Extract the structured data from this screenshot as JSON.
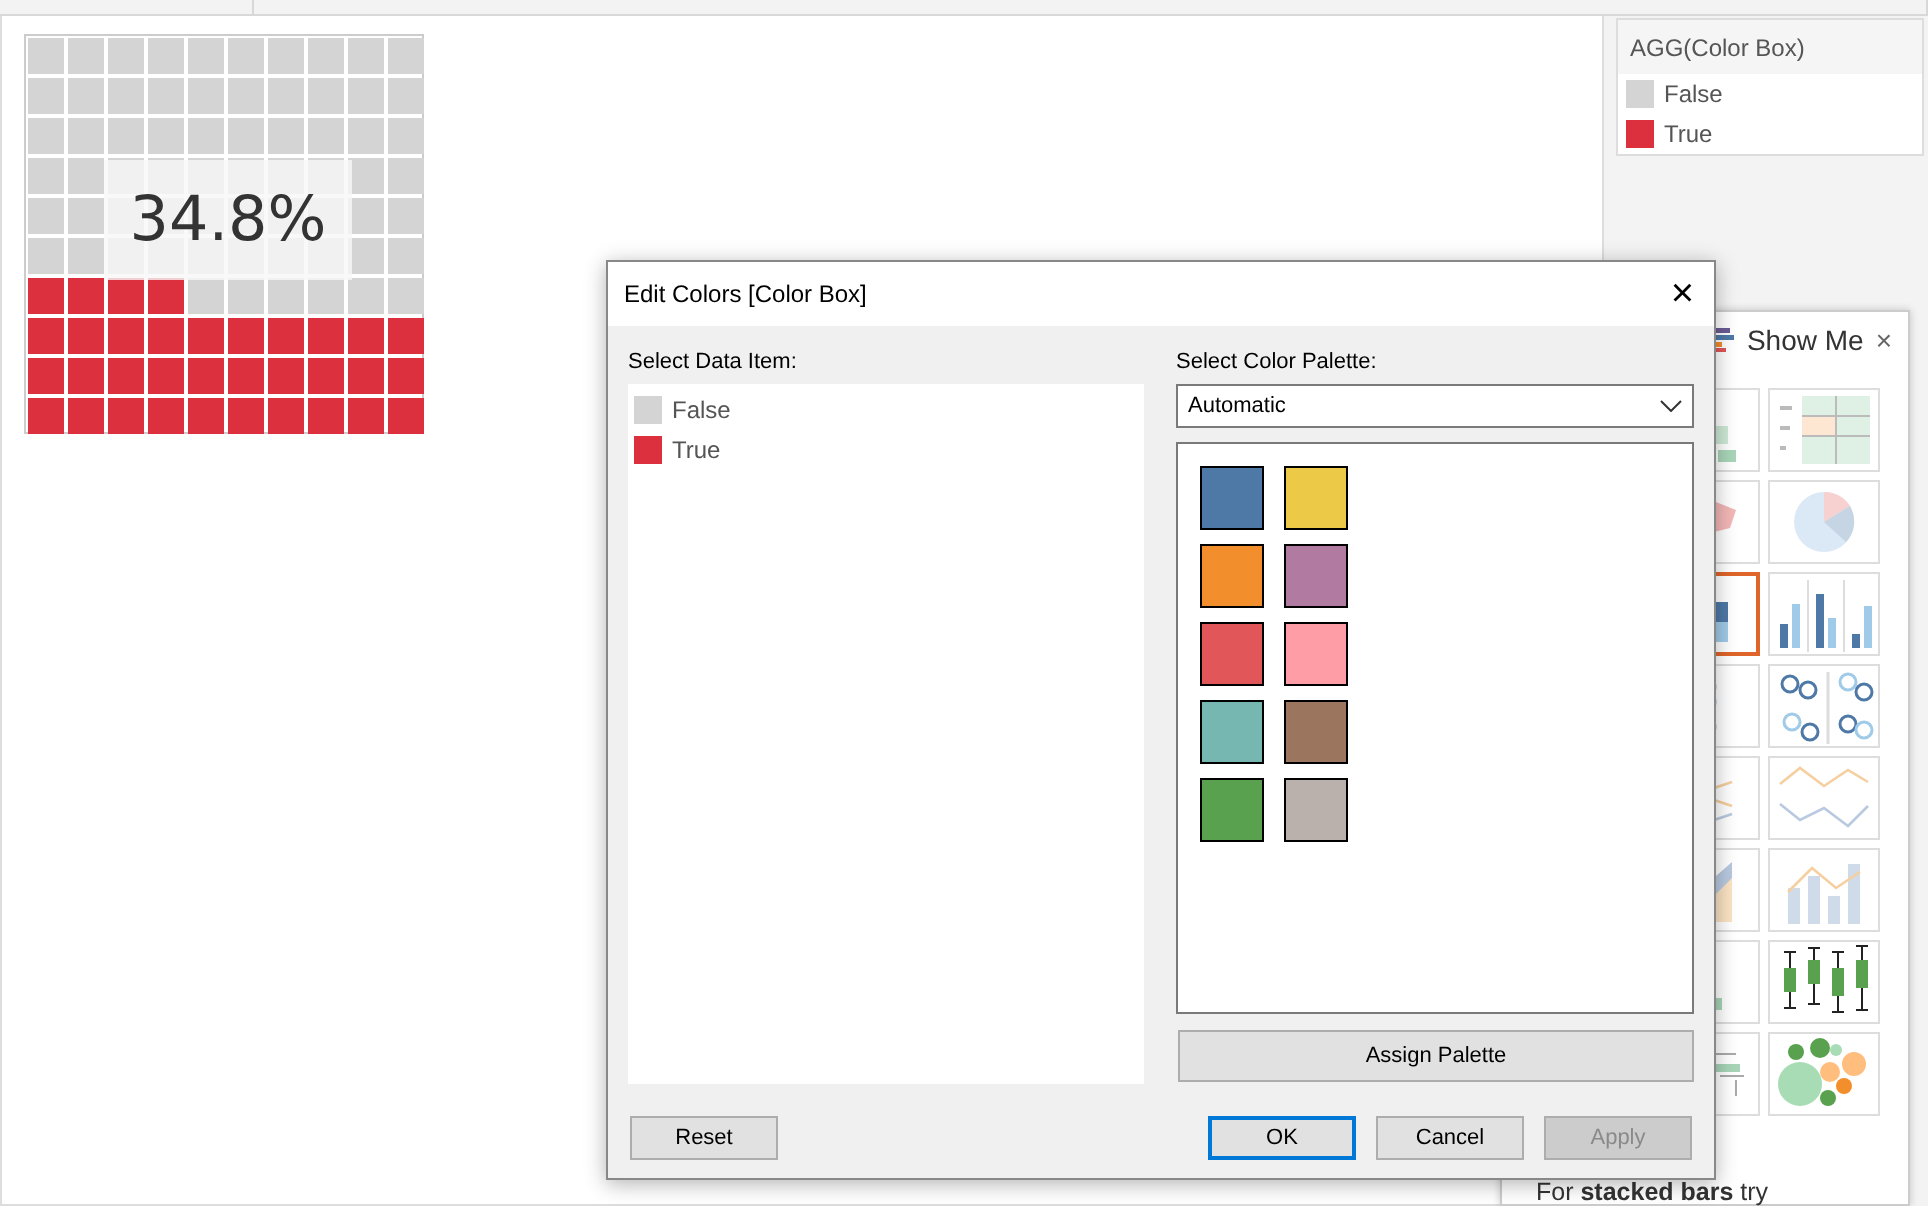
{
  "view": {
    "waffle": {
      "level": 0.34,
      "label": "34.8%"
    }
  },
  "legend": {
    "title": "AGG(Color Box)",
    "items": [
      {
        "label": "False",
        "color": "#d4d4d4"
      },
      {
        "label": "True",
        "color": "#dc303e"
      }
    ]
  },
  "show_me": {
    "title": "Show Me",
    "close": "×",
    "hint": "For **stacked bars** try",
    "thumbnails": [
      {
        "kind": "heat-map",
        "selected": false
      },
      {
        "kind": "highlight-table",
        "selected": false
      },
      {
        "kind": "map",
        "selected": false
      },
      {
        "kind": "pie",
        "selected": false
      },
      {
        "kind": "stacked-bars",
        "selected": true
      },
      {
        "kind": "side-by-side-bars",
        "selected": false
      },
      {
        "kind": "circles",
        "selected": false
      },
      {
        "kind": "side-by-side-circles",
        "selected": false
      },
      {
        "kind": "lines",
        "selected": false
      },
      {
        "kind": "dual-lines",
        "selected": false
      },
      {
        "kind": "area",
        "selected": false
      },
      {
        "kind": "bar-line",
        "selected": false
      },
      {
        "kind": "histogram",
        "selected": false
      },
      {
        "kind": "box-plot",
        "selected": false
      },
      {
        "kind": "gantt",
        "selected": false
      },
      {
        "kind": "bubbles",
        "selected": false
      }
    ]
  },
  "dialog": {
    "title": "Edit Colors [Color Box]",
    "close": "×",
    "data_label": "Select Data Item:",
    "data_items": [
      {
        "label": "False",
        "color": "#d4d4d4"
      },
      {
        "label": "True",
        "color": "#dc303e"
      }
    ],
    "palette_label": "Select Color Palette:",
    "palette": "Automatic",
    "swatches": [
      {
        "color": "#4e79a7"
      },
      {
        "color": "#edc948"
      },
      {
        "color": "#f28e2b"
      },
      {
        "color": "#b07aa1"
      },
      {
        "color": "#e15759"
      },
      {
        "color": "#ff9da7"
      },
      {
        "color": "#76b7b2"
      },
      {
        "color": "#9c755f"
      },
      {
        "color": "#59a14f"
      },
      {
        "color": "#bab0ac"
      }
    ],
    "assign": "Assign Palette",
    "reset": "Reset",
    "buttons": [
      {
        "label": "OK",
        "kind": "primary",
        "disabled": false
      },
      {
        "label": "Cancel",
        "kind": "normal",
        "disabled": false
      },
      {
        "label": "Apply",
        "kind": "normal",
        "disabled": true
      }
    ]
  }
}
